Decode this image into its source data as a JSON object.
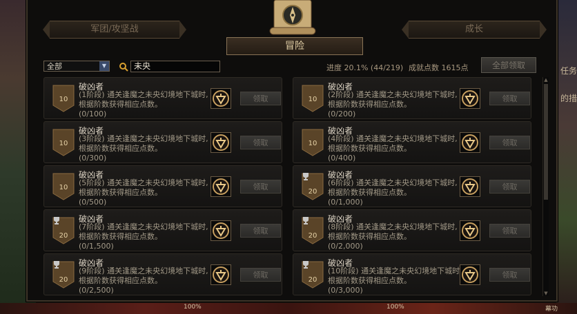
{
  "tabs": {
    "left": "军团/攻坚战",
    "right": "成长",
    "active": "冒险"
  },
  "filter": {
    "selected": "全部"
  },
  "search": {
    "value": "未央"
  },
  "stats": {
    "progress": "进度 20.1% (44/219)",
    "points": "成就点数 1615点"
  },
  "claim_all_label": "全部领取",
  "side_text": {
    "line1": "任务",
    "line2": "的措"
  },
  "bottom_bar": {
    "left_pct": "100%",
    "right_pct": "100%",
    "right_label": "幕功"
  },
  "achievements": [
    {
      "title": "破凶者",
      "desc": "(1阶段) 通关逢魔之未央幻境地下城时, 根据阶数获得相应点数。",
      "progress": "(0/100)",
      "points": "10",
      "cup": false,
      "claim": "领取"
    },
    {
      "title": "破凶者",
      "desc": "(2阶段) 通关逢魔之未央幻境地下城时, 根据阶数获得相应点数。",
      "progress": "(0/200)",
      "points": "10",
      "cup": false,
      "claim": "领取"
    },
    {
      "title": "破凶者",
      "desc": "(3阶段) 通关逢魔之未央幻境地下城时, 根据阶数获得相应点数。",
      "progress": "(0/300)",
      "points": "10",
      "cup": false,
      "claim": "领取"
    },
    {
      "title": "破凶者",
      "desc": "(4阶段) 通关逢魔之未央幻境地下城时, 根据阶数获得相应点数。",
      "progress": "(0/400)",
      "points": "10",
      "cup": false,
      "claim": "领取"
    },
    {
      "title": "破凶者",
      "desc": "(5阶段) 通关逢魔之未央幻境地下城时, 根据阶数获得相应点数。",
      "progress": "(0/500)",
      "points": "10",
      "cup": false,
      "claim": "领取"
    },
    {
      "title": "破凶者",
      "desc": "(6阶段) 通关逢魔之未央幻境地下城时, 根据阶数获得相应点数。",
      "progress": "(0/1,000)",
      "points": "20",
      "cup": true,
      "claim": "领取"
    },
    {
      "title": "破凶者",
      "desc": "(7阶段) 通关逢魔之未央幻境地下城时, 根据阶数获得相应点数。",
      "progress": "(0/1,500)",
      "points": "20",
      "cup": true,
      "claim": "领取"
    },
    {
      "title": "破凶者",
      "desc": "(8阶段) 通关逢魔之未央幻境地下城时, 根据阶数获得相应点数。",
      "progress": "(0/2,000)",
      "points": "20",
      "cup": true,
      "claim": "领取"
    },
    {
      "title": "破凶者",
      "desc": "(9阶段) 通关逢魔之未央幻境地下城时, 根据阶数获得相应点数。",
      "progress": "(0/2,500)",
      "points": "20",
      "cup": true,
      "claim": "领取"
    },
    {
      "title": "破凶者",
      "desc": "(10阶段) 通关逢魔之未央幻境地下城时, 根据阶数获得相应点数。",
      "progress": "(0/3,000)",
      "points": "20",
      "cup": true,
      "claim": "领取"
    }
  ],
  "colors": {
    "gold_text": "#e2cfa6",
    "panel_bg": "#0e0d0c",
    "card_bg": "#1c1a18",
    "muted_text": "#a39a88"
  }
}
